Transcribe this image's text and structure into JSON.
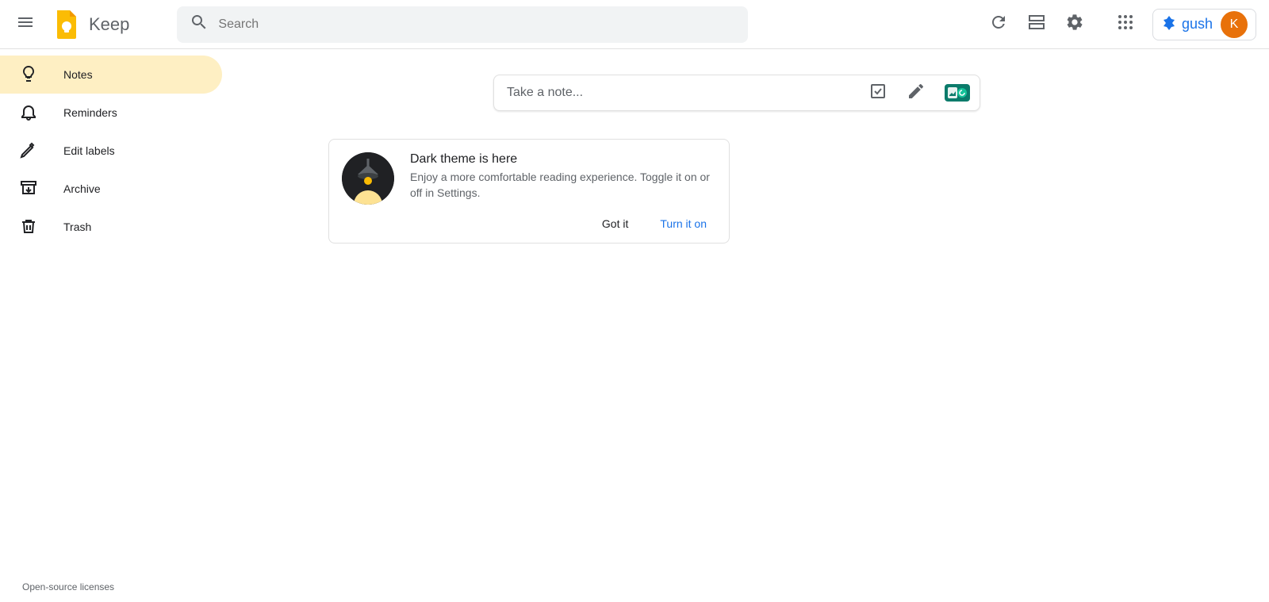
{
  "header": {
    "app_name": "Keep",
    "search_placeholder": "Search",
    "gush_label": "gush",
    "avatar_letter": "K"
  },
  "sidebar": {
    "items": [
      {
        "label": "Notes",
        "active": true
      },
      {
        "label": "Reminders",
        "active": false
      },
      {
        "label": "Edit labels",
        "active": false
      },
      {
        "label": "Archive",
        "active": false
      },
      {
        "label": "Trash",
        "active": false
      }
    ]
  },
  "take_note": {
    "placeholder": "Take a note..."
  },
  "promo": {
    "title": "Dark theme is here",
    "body": "Enjoy a more comfortable reading experience. Toggle it on or off in Settings.",
    "dismiss_label": "Got it",
    "action_label": "Turn it on"
  },
  "footer": {
    "licenses": "Open-source licenses"
  },
  "colors": {
    "accent": "#feefc3",
    "link": "#1a73e8",
    "avatar": "#e8710a"
  }
}
